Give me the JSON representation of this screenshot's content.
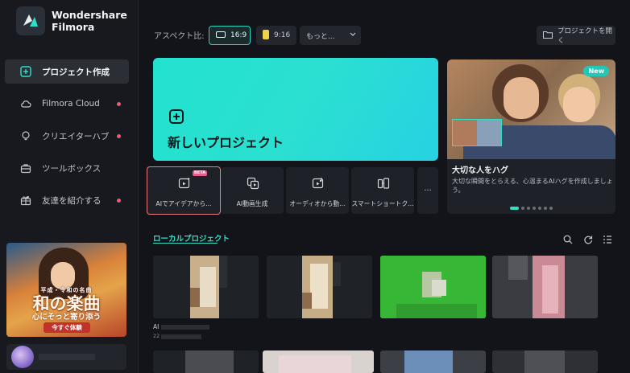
{
  "brand": {
    "line1": "Wondershare",
    "line2": "Filmora"
  },
  "nav": [
    {
      "label": "プロジェクト作成",
      "icon": "plus-square-icon",
      "active": true,
      "dot": false
    },
    {
      "label": "Filmora Cloud",
      "icon": "cloud-icon",
      "active": false,
      "dot": true
    },
    {
      "label": "クリエイターハブ",
      "icon": "bulb-icon",
      "active": false,
      "dot": true
    },
    {
      "label": "ツールボックス",
      "icon": "toolbox-icon",
      "active": false,
      "dot": false
    },
    {
      "label": "友達を紹介する",
      "icon": "gift-icon",
      "active": false,
      "dot": true
    }
  ],
  "promo": {
    "line1": "平成・令和の名曲",
    "line2": "和の楽曲",
    "line3": "心にそっと寄り添う",
    "cta": "今すぐ体験"
  },
  "toolbar": {
    "aspect_label": "アスペクト比:",
    "ratio_169": "16:9",
    "ratio_916": "9:16",
    "ratio_more": "もっと...",
    "open_project": "プロジェクトを開く"
  },
  "hero": {
    "title": "新しいプロジェクト"
  },
  "feature": {
    "badge": "New",
    "title": "大切な人をハグ",
    "desc": "大切な瞬間をとらえる、心温まるAIハグを作成しましょう。",
    "slides": 7,
    "active_slide": 0
  },
  "quick_actions": [
    {
      "label": "AIでアイデアから...",
      "icon": "ai-idea-icon",
      "badge": "BETA"
    },
    {
      "label": "AI動画生成",
      "icon": "ai-video-icon"
    },
    {
      "label": "オーディオから動...",
      "icon": "audio-to-video-icon"
    },
    {
      "label": "スマートショートク...",
      "icon": "smart-short-icon"
    }
  ],
  "more_label": "...",
  "local": {
    "title": "ローカルプロジェクト",
    "caption1": "AI",
    "caption2": "22"
  },
  "colors": {
    "accent": "#2fe0c6",
    "hero": "#22e2cf",
    "highlight": "#ee7c7c",
    "dot": "#ef5b6a"
  }
}
